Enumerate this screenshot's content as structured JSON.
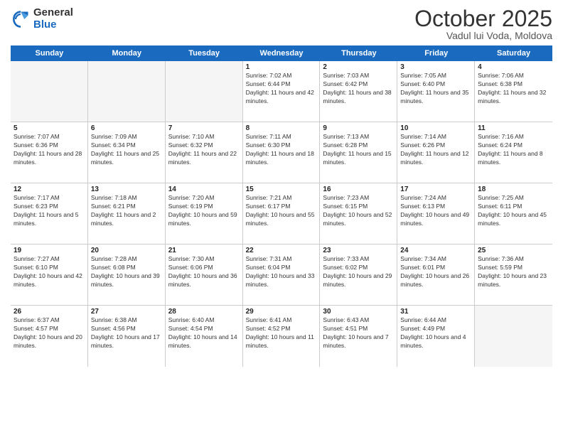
{
  "header": {
    "logo_general": "General",
    "logo_blue": "Blue",
    "month_title": "October 2025",
    "subtitle": "Vadul lui Voda, Moldova"
  },
  "days_of_week": [
    "Sunday",
    "Monday",
    "Tuesday",
    "Wednesday",
    "Thursday",
    "Friday",
    "Saturday"
  ],
  "weeks": [
    [
      {
        "day": "",
        "empty": true
      },
      {
        "day": "",
        "empty": true
      },
      {
        "day": "",
        "empty": true
      },
      {
        "day": "1",
        "sunrise": "7:02 AM",
        "sunset": "6:44 PM",
        "daylight": "11 hours and 42 minutes."
      },
      {
        "day": "2",
        "sunrise": "7:03 AM",
        "sunset": "6:42 PM",
        "daylight": "11 hours and 38 minutes."
      },
      {
        "day": "3",
        "sunrise": "7:05 AM",
        "sunset": "6:40 PM",
        "daylight": "11 hours and 35 minutes."
      },
      {
        "day": "4",
        "sunrise": "7:06 AM",
        "sunset": "6:38 PM",
        "daylight": "11 hours and 32 minutes."
      }
    ],
    [
      {
        "day": "5",
        "sunrise": "7:07 AM",
        "sunset": "6:36 PM",
        "daylight": "11 hours and 28 minutes."
      },
      {
        "day": "6",
        "sunrise": "7:09 AM",
        "sunset": "6:34 PM",
        "daylight": "11 hours and 25 minutes."
      },
      {
        "day": "7",
        "sunrise": "7:10 AM",
        "sunset": "6:32 PM",
        "daylight": "11 hours and 22 minutes."
      },
      {
        "day": "8",
        "sunrise": "7:11 AM",
        "sunset": "6:30 PM",
        "daylight": "11 hours and 18 minutes."
      },
      {
        "day": "9",
        "sunrise": "7:13 AM",
        "sunset": "6:28 PM",
        "daylight": "11 hours and 15 minutes."
      },
      {
        "day": "10",
        "sunrise": "7:14 AM",
        "sunset": "6:26 PM",
        "daylight": "11 hours and 12 minutes."
      },
      {
        "day": "11",
        "sunrise": "7:16 AM",
        "sunset": "6:24 PM",
        "daylight": "11 hours and 8 minutes."
      }
    ],
    [
      {
        "day": "12",
        "sunrise": "7:17 AM",
        "sunset": "6:23 PM",
        "daylight": "11 hours and 5 minutes."
      },
      {
        "day": "13",
        "sunrise": "7:18 AM",
        "sunset": "6:21 PM",
        "daylight": "11 hours and 2 minutes."
      },
      {
        "day": "14",
        "sunrise": "7:20 AM",
        "sunset": "6:19 PM",
        "daylight": "10 hours and 59 minutes."
      },
      {
        "day": "15",
        "sunrise": "7:21 AM",
        "sunset": "6:17 PM",
        "daylight": "10 hours and 55 minutes."
      },
      {
        "day": "16",
        "sunrise": "7:23 AM",
        "sunset": "6:15 PM",
        "daylight": "10 hours and 52 minutes."
      },
      {
        "day": "17",
        "sunrise": "7:24 AM",
        "sunset": "6:13 PM",
        "daylight": "10 hours and 49 minutes."
      },
      {
        "day": "18",
        "sunrise": "7:25 AM",
        "sunset": "6:11 PM",
        "daylight": "10 hours and 45 minutes."
      }
    ],
    [
      {
        "day": "19",
        "sunrise": "7:27 AM",
        "sunset": "6:10 PM",
        "daylight": "10 hours and 42 minutes."
      },
      {
        "day": "20",
        "sunrise": "7:28 AM",
        "sunset": "6:08 PM",
        "daylight": "10 hours and 39 minutes."
      },
      {
        "day": "21",
        "sunrise": "7:30 AM",
        "sunset": "6:06 PM",
        "daylight": "10 hours and 36 minutes."
      },
      {
        "day": "22",
        "sunrise": "7:31 AM",
        "sunset": "6:04 PM",
        "daylight": "10 hours and 33 minutes."
      },
      {
        "day": "23",
        "sunrise": "7:33 AM",
        "sunset": "6:02 PM",
        "daylight": "10 hours and 29 minutes."
      },
      {
        "day": "24",
        "sunrise": "7:34 AM",
        "sunset": "6:01 PM",
        "daylight": "10 hours and 26 minutes."
      },
      {
        "day": "25",
        "sunrise": "7:36 AM",
        "sunset": "5:59 PM",
        "daylight": "10 hours and 23 minutes."
      }
    ],
    [
      {
        "day": "26",
        "sunrise": "6:37 AM",
        "sunset": "4:57 PM",
        "daylight": "10 hours and 20 minutes."
      },
      {
        "day": "27",
        "sunrise": "6:38 AM",
        "sunset": "4:56 PM",
        "daylight": "10 hours and 17 minutes."
      },
      {
        "day": "28",
        "sunrise": "6:40 AM",
        "sunset": "4:54 PM",
        "daylight": "10 hours and 14 minutes."
      },
      {
        "day": "29",
        "sunrise": "6:41 AM",
        "sunset": "4:52 PM",
        "daylight": "10 hours and 11 minutes."
      },
      {
        "day": "30",
        "sunrise": "6:43 AM",
        "sunset": "4:51 PM",
        "daylight": "10 hours and 7 minutes."
      },
      {
        "day": "31",
        "sunrise": "6:44 AM",
        "sunset": "4:49 PM",
        "daylight": "10 hours and 4 minutes."
      },
      {
        "day": "",
        "empty": true
      }
    ]
  ],
  "labels": {
    "sunrise": "Sunrise:",
    "sunset": "Sunset:",
    "daylight": "Daylight:"
  }
}
